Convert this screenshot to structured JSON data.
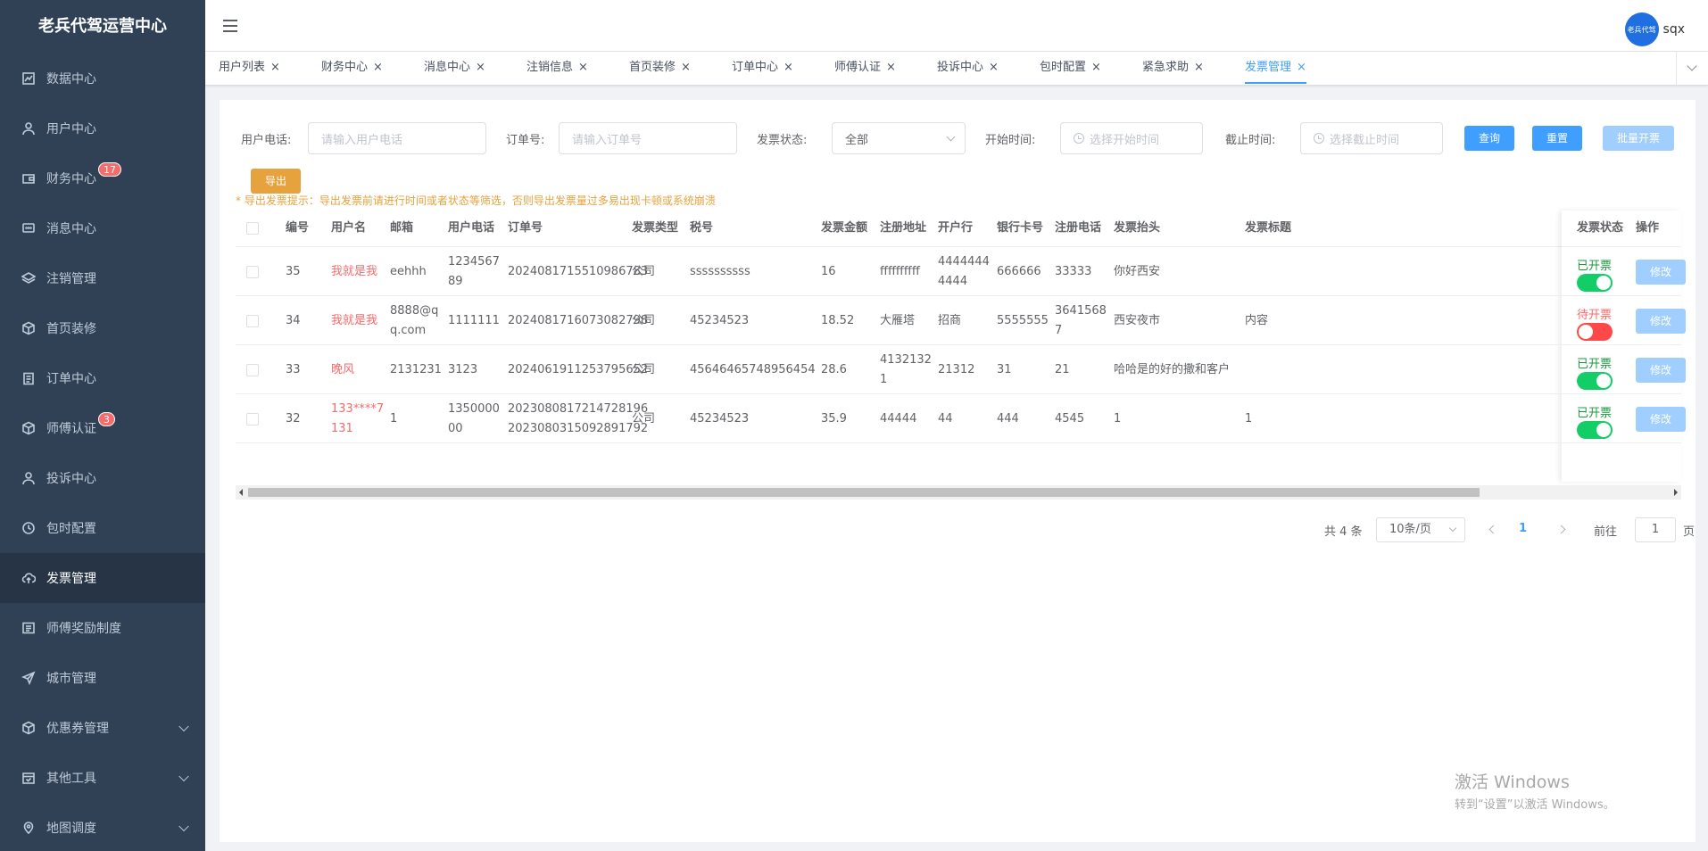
{
  "app": {
    "title": "老兵代驾运营中心"
  },
  "sidebar": {
    "items": [
      {
        "label": "数据中心",
        "icon": "chart-icon"
      },
      {
        "label": "用户中心",
        "icon": "user-icon"
      },
      {
        "label": "财务中心",
        "icon": "wallet-icon",
        "badge": "17"
      },
      {
        "label": "消息中心",
        "icon": "message-icon"
      },
      {
        "label": "注销管理",
        "icon": "layers-icon"
      },
      {
        "label": "首页装修",
        "icon": "cube-icon"
      },
      {
        "label": "订单中心",
        "icon": "clipboard-icon"
      },
      {
        "label": "师傅认证",
        "icon": "cube-icon",
        "badge": "3"
      },
      {
        "label": "投诉中心",
        "icon": "user-icon"
      },
      {
        "label": "包时配置",
        "icon": "clock-icon"
      },
      {
        "label": "发票管理",
        "icon": "cloud-upload-icon",
        "active": true
      },
      {
        "label": "师傅奖励制度",
        "icon": "list-icon"
      },
      {
        "label": "城市管理",
        "icon": "send-icon"
      },
      {
        "label": "优惠券管理",
        "icon": "cube-icon",
        "expandable": true
      },
      {
        "label": "其他工具",
        "icon": "calendar-icon",
        "expandable": true
      },
      {
        "label": "地图调度",
        "icon": "location-icon",
        "expandable": true
      }
    ]
  },
  "header": {
    "username": "sqx",
    "avatar_text": "老兵代驾"
  },
  "tabs": [
    "用户列表",
    "财务中心",
    "消息中心",
    "注销信息",
    "首页装修",
    "订单中心",
    "师傅认证",
    "投诉中心",
    "包时配置",
    "紧急求助",
    "发票管理"
  ],
  "active_tab": "发票管理",
  "filters": {
    "phone_label": "用户电话:",
    "phone_placeholder": "请输入用户电话",
    "order_label": "订单号:",
    "order_placeholder": "请输入订单号",
    "status_label": "发票状态:",
    "status_value": "全部",
    "start_label": "开始时间:",
    "start_placeholder": "选择开始时间",
    "end_label": "截止时间:",
    "end_placeholder": "选择截止时间",
    "query_btn": "查询",
    "reset_btn": "重置",
    "batch_btn": "批量开票",
    "export_btn": "导出",
    "tip": "* 导出发票提示：导出发票前请进行时间或者状态等筛选，否则导出发票量过多易出现卡顿或系统崩溃"
  },
  "table": {
    "headers": [
      "编号",
      "用户名",
      "邮箱",
      "用户电话",
      "订单号",
      "发票类型",
      "税号",
      "发票金额",
      "注册地址",
      "开户行",
      "银行卡号",
      "注册电话",
      "发票抬头",
      "发票标题",
      "发票状态",
      "操作"
    ],
    "rows": [
      {
        "id": "35",
        "username": [
          "我就是我"
        ],
        "email": [
          "eehhh"
        ],
        "phone": [
          "1234567",
          "89"
        ],
        "order": [
          "2024081715510986783"
        ],
        "type": "公司",
        "tax": "ssssssssss",
        "amount": "16",
        "address": [
          "ffffffffff"
        ],
        "bank": [
          "4444444",
          "4444"
        ],
        "card": "666666",
        "reg_phone": [
          "33333"
        ],
        "header": "你好西安",
        "title": "",
        "status": "已开票",
        "issued": true,
        "action": "修改"
      },
      {
        "id": "34",
        "username": [
          "我就是我"
        ],
        "email": [
          "8888@q",
          "q.com"
        ],
        "phone": [
          "1111111"
        ],
        "order": [
          "2024081716073082798"
        ],
        "type": "公司",
        "tax": "45234523",
        "amount": "18.52",
        "address": [
          "大雁塔"
        ],
        "bank": [
          "招商"
        ],
        "card": "5555555",
        "reg_phone": [
          "3641568",
          "7"
        ],
        "header": "西安夜市",
        "title": "内容",
        "status": "待开票",
        "issued": false,
        "action": "修改"
      },
      {
        "id": "33",
        "username": [
          "晚风"
        ],
        "email": [
          "2131231"
        ],
        "phone": [
          "3123"
        ],
        "order": [
          "2024061911253795652"
        ],
        "type": "公司",
        "tax": "45646465748956454",
        "amount": "28.6",
        "address": [
          "4132132",
          "1"
        ],
        "bank": [
          "21312"
        ],
        "card": "31",
        "reg_phone": [
          "21"
        ],
        "header": "哈哈是的好的撒和客户",
        "title": "",
        "status": "已开票",
        "issued": true,
        "action": "修改"
      },
      {
        "id": "32",
        "username": [
          "133****7",
          "131"
        ],
        "email": [
          "1"
        ],
        "phone": [
          "1350000",
          "00"
        ],
        "order": [
          "2023080817214728196",
          "2023080315092891792"
        ],
        "type": "公司",
        "tax": "45234523",
        "amount": "35.9",
        "address": [
          "44444"
        ],
        "bank": [
          "44"
        ],
        "card": "444",
        "reg_phone": [
          "4545"
        ],
        "header": "1",
        "title": "1",
        "status": "已开票",
        "issued": true,
        "action": "修改"
      }
    ]
  },
  "pagination": {
    "total": "共 4 条",
    "page_size": "10条/页",
    "current": "1",
    "goto_label": "前往",
    "goto_value": "1",
    "page_label": "页"
  },
  "watermark": {
    "line1": "激活 Windows",
    "line2": "转到“设置”以激活 Windows。"
  },
  "colors": {
    "sidebar_bg": "#304156",
    "primary": "#409eff",
    "warning": "#e6a23c",
    "danger": "#f56c6c",
    "success": "#13ce66"
  }
}
